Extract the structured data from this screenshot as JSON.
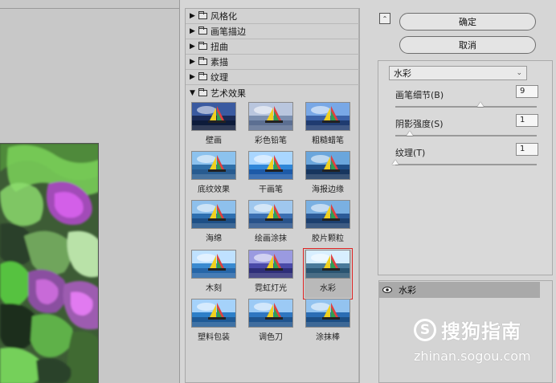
{
  "gallery": {
    "categories": [
      {
        "label": "风格化",
        "state": "collapsed"
      },
      {
        "label": "画笔描边",
        "state": "collapsed"
      },
      {
        "label": "扭曲",
        "state": "collapsed"
      },
      {
        "label": "素描",
        "state": "collapsed"
      },
      {
        "label": "纹理",
        "state": "collapsed"
      },
      {
        "label": "艺术效果",
        "state": "expanded"
      }
    ],
    "thumbnails": [
      {
        "label": "壁画"
      },
      {
        "label": "彩色铅笔"
      },
      {
        "label": "粗糙蜡笔"
      },
      {
        "label": "底纹效果"
      },
      {
        "label": "干画笔"
      },
      {
        "label": "海报边缘"
      },
      {
        "label": "海绵"
      },
      {
        "label": "绘画涂抹"
      },
      {
        "label": "胶片颗粒"
      },
      {
        "label": "木刻"
      },
      {
        "label": "霓虹灯光"
      },
      {
        "label": "水彩"
      },
      {
        "label": "塑料包装"
      },
      {
        "label": "调色刀"
      },
      {
        "label": "涂抹棒"
      }
    ],
    "selected_thumbnail": "水彩",
    "arrows": {
      "collapsed": "▶",
      "expanded": "▼"
    }
  },
  "options": {
    "collapse_icon": "⌃",
    "ok_label": "确定",
    "cancel_label": "取消",
    "selected_filter": "水彩",
    "params": [
      {
        "label": "画笔细节(B)",
        "value": "9",
        "level": 0.6
      },
      {
        "label": "阴影强度(S)",
        "value": "1",
        "level": 0.1
      },
      {
        "label": "纹理(T)",
        "value": "1",
        "level": 0.0
      }
    ]
  },
  "layers": {
    "active_layer": "水彩"
  },
  "watermark": {
    "logo_letter": "S",
    "name": "搜狗指南",
    "url": "zhinan.sogou.com"
  }
}
